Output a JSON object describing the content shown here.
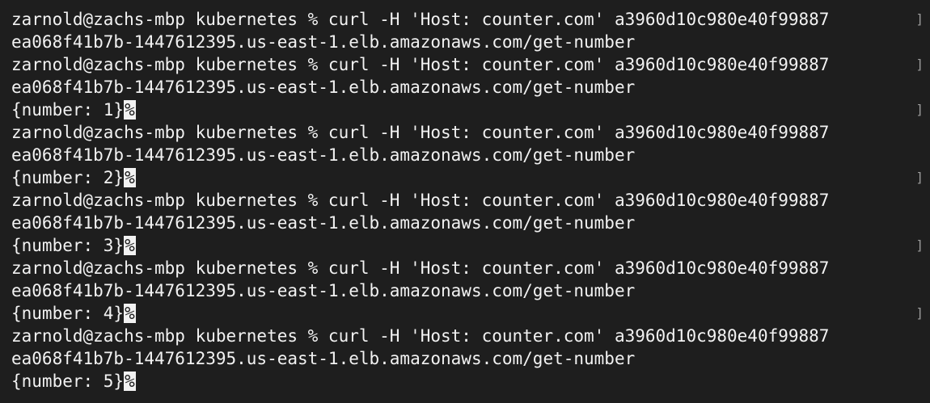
{
  "terminal": {
    "command_line": "zarnold@zachs-mbp kubernetes % curl -H 'Host: counter.com' a3960d10c980e40f99887",
    "command_continuation": "ea068f41b7b-1447612395.us-east-1.elb.amazonaws.com/get-number",
    "wrap_marker": "]",
    "eol_marker": "%",
    "outputs": [
      "{number: 1}",
      "{number: 2}",
      "{number: 3}",
      "{number: 4}",
      "{number: 5}"
    ]
  },
  "colors": {
    "background": "#1e1e1e",
    "text": "#f2f2f2",
    "marker": "#9a9a9a"
  }
}
